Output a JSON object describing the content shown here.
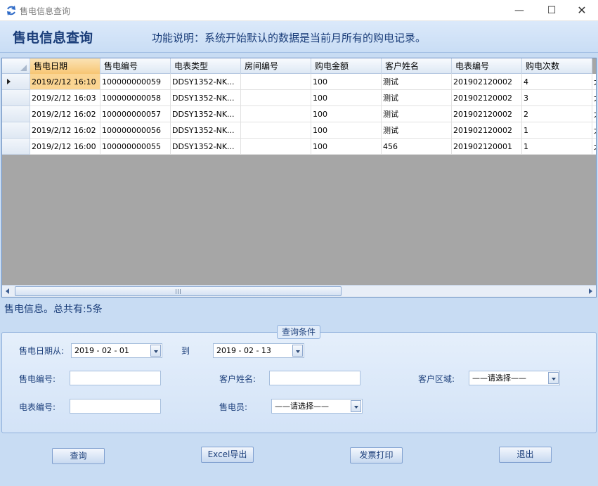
{
  "window": {
    "title": "售电信息查询",
    "app_icon": "refresh-icon",
    "minimize_glyph": "—",
    "maximize_glyph": "☐",
    "close_glyph": "✕"
  },
  "header": {
    "title": "售电信息查询",
    "description": "功能说明：系统开始默认的数据是当前月所有的购电记录。"
  },
  "grid": {
    "columns": [
      "售电日期",
      "售电编号",
      "电表类型",
      "房间编号",
      "购电金额",
      "客户姓名",
      "电表编号",
      "购电次数"
    ],
    "rows": [
      [
        "2019/2/12 16:10",
        "100000000059",
        "DDSY1352-NK...",
        "",
        "100",
        "测试",
        "201902120002",
        "4"
      ],
      [
        "2019/2/12 16:03",
        "100000000058",
        "DDSY1352-NK...",
        "",
        "100",
        "测试",
        "201902120002",
        "3"
      ],
      [
        "2019/2/12 16:02",
        "100000000057",
        "DDSY1352-NK...",
        "",
        "100",
        "测试",
        "201902120002",
        "2"
      ],
      [
        "2019/2/12 16:02",
        "100000000056",
        "DDSY1352-NK...",
        "",
        "100",
        "测试",
        "201902120002",
        "1"
      ],
      [
        "2019/2/12 16:00",
        "100000000055",
        "DDSY1352-NK...",
        "",
        "100",
        "456",
        "201902120001",
        "1"
      ]
    ],
    "overflow_mark": "大",
    "selected_row": 0,
    "sorted_column": 0
  },
  "summary": "售电信息。总共有:5条",
  "query": {
    "group_title": "查询条件",
    "date_from_label": "售电日期从:",
    "date_from_value": "2019 - 02 - 01",
    "to_label": "到",
    "date_to_value": "2019 - 02 - 13",
    "sale_no_label": "售电编号:",
    "sale_no_value": "",
    "customer_name_label": "客户姓名:",
    "customer_name_value": "",
    "customer_area_label": "客户区域:",
    "customer_area_value": "——请选择——",
    "meter_no_label": "电表编号:",
    "meter_no_value": "",
    "seller_label": "售电员:",
    "seller_value": "——请选择——"
  },
  "buttons": {
    "query": "查询",
    "excel": "Excel导出",
    "invoice": "发票打印",
    "exit": "退出"
  }
}
